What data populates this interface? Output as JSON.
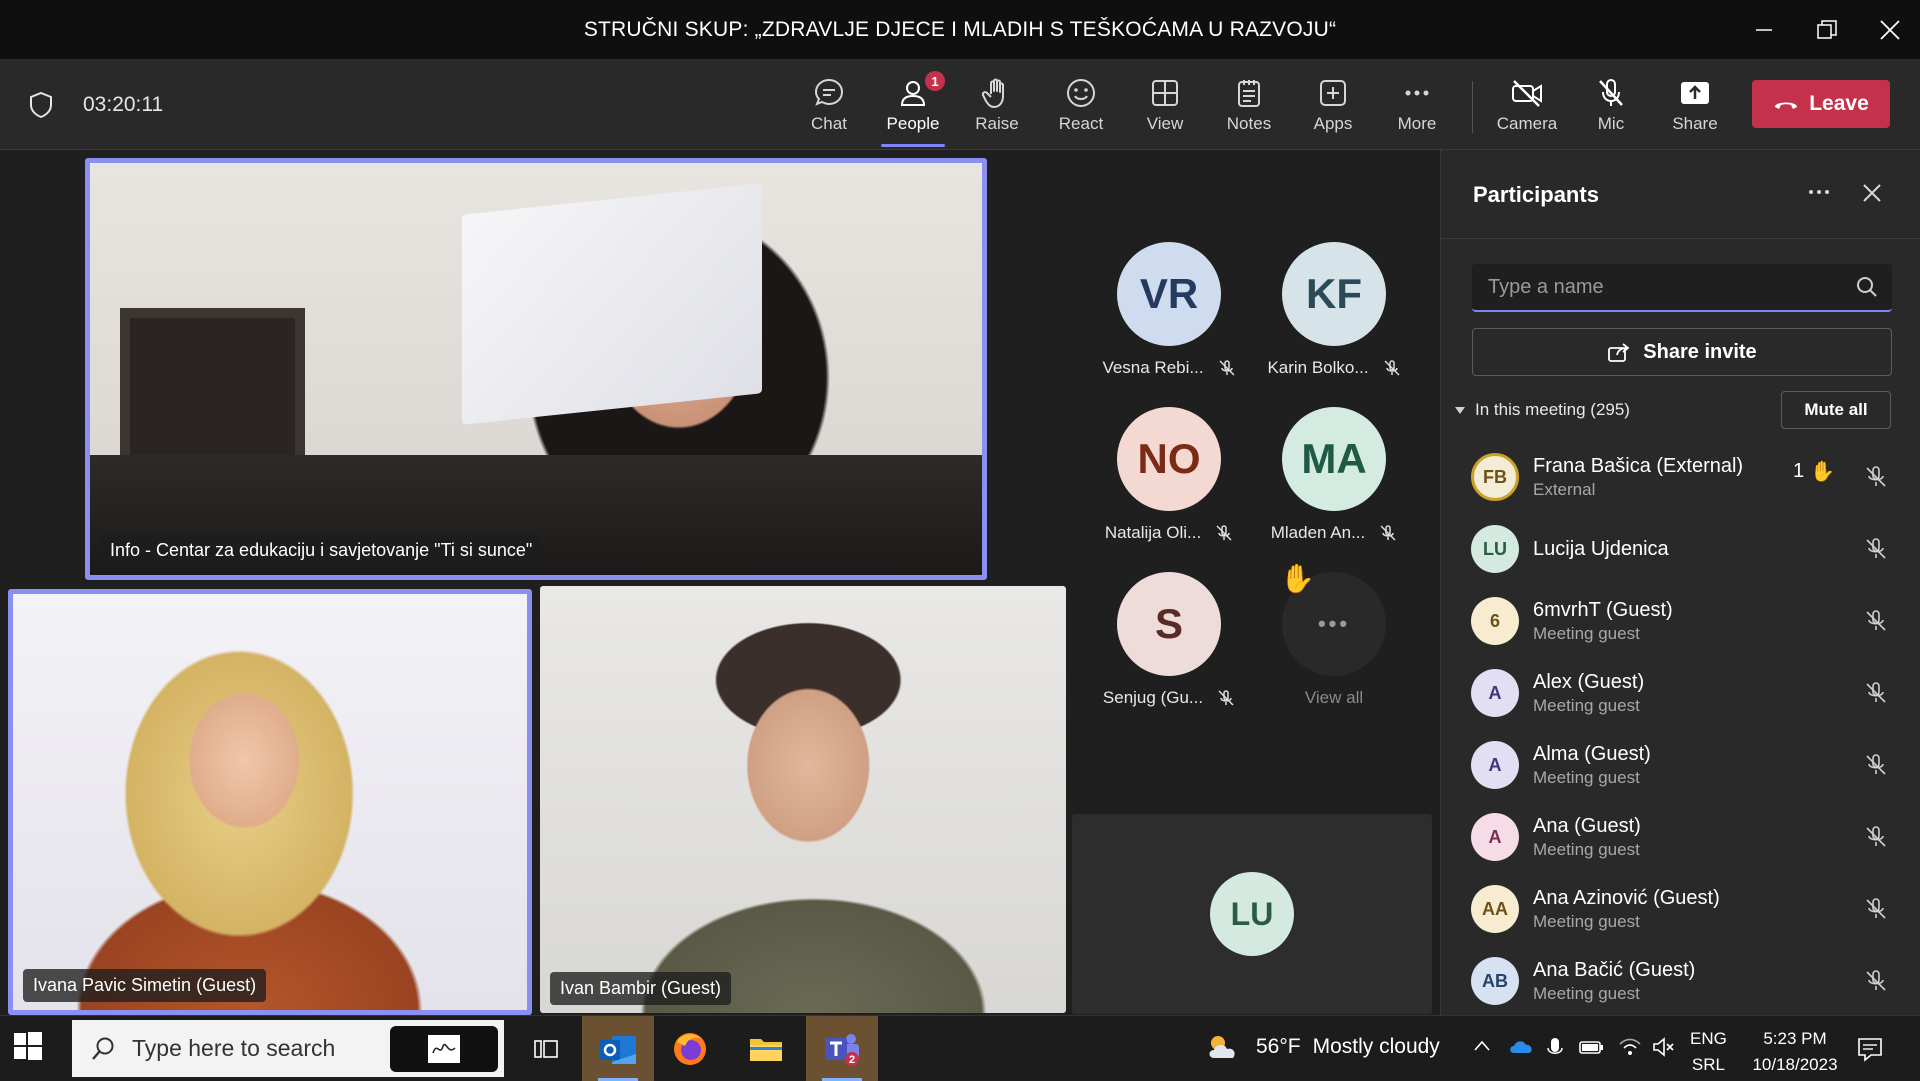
{
  "window": {
    "title": "STRUČNI SKUP: „ZDRAVLJE DJECE I MLADIH S TEŠKOĆAMA U RAZVOJU“"
  },
  "toolbar": {
    "timer": "03:20:11",
    "buttons": {
      "chat": "Chat",
      "people": "People",
      "people_badge": "1",
      "raise": "Raise",
      "react": "React",
      "view": "View",
      "notes": "Notes",
      "apps": "Apps",
      "more": "More",
      "camera": "Camera",
      "mic": "Mic",
      "share": "Share"
    },
    "leave": "Leave"
  },
  "stage": {
    "main_tile": {
      "name": "Info - Centar za edukaciju i savjetovanje \"Ti si sunce\""
    },
    "tile_left": {
      "name": "Ivana Pavic Simetin (Guest)"
    },
    "tile_right": {
      "name": "Ivan Bambir (Guest)"
    },
    "avatars": [
      {
        "initials": "VR",
        "name": "Vesna Rebi...",
        "bg": "#cfdcef",
        "fg": "#243a5e"
      },
      {
        "initials": "KF",
        "name": "Karin Bolko...",
        "bg": "#d6e4ea",
        "fg": "#2b4a57"
      },
      {
        "initials": "NO",
        "name": "Natalija Oli...",
        "bg": "#f3d9d2",
        "fg": "#7a2a16"
      },
      {
        "initials": "MA",
        "name": "Mladen An...",
        "bg": "#d4ebe2",
        "fg": "#1f5a45"
      },
      {
        "initials": "S",
        "name": "Senjug (Gu...",
        "bg": "#eddcda",
        "fg": "#5a2b25"
      }
    ],
    "view_all": {
      "label": "View all",
      "dots": "•••"
    },
    "self_tile": {
      "initials": "LU"
    }
  },
  "panel": {
    "title": "Participants",
    "search_placeholder": "Type a name",
    "share_invite": "Share invite",
    "section": "In this meeting (295)",
    "mute_all": "Mute all",
    "participants": [
      {
        "initials": "FB",
        "name": "Frana Bašica (External)",
        "role": "External",
        "bg": "#f3ecd6",
        "fg": "#6b5318",
        "hand": "1"
      },
      {
        "initials": "LU",
        "name": "Lucija Ujdenica",
        "role": "",
        "bg": "#d4e9e0",
        "fg": "#2a5a48"
      },
      {
        "initials": "6",
        "name": "6mvrhT (Guest)",
        "role": "Meeting guest",
        "bg": "#f7ecd0",
        "fg": "#6b5318"
      },
      {
        "initials": "A",
        "name": "Alex (Guest)",
        "role": "Meeting guest",
        "bg": "#e2dff4",
        "fg": "#3e3775"
      },
      {
        "initials": "A",
        "name": "Alma (Guest)",
        "role": "Meeting guest",
        "bg": "#e2dff4",
        "fg": "#3e3775"
      },
      {
        "initials": "A",
        "name": "Ana (Guest)",
        "role": "Meeting guest",
        "bg": "#f6dce6",
        "fg": "#7a2e4c"
      },
      {
        "initials": "AA",
        "name": "Ana Azinović (Guest)",
        "role": "Meeting guest",
        "bg": "#f7ecd0",
        "fg": "#6b5318"
      },
      {
        "initials": "AB",
        "name": "Ana Bačić (Guest)",
        "role": "Meeting guest",
        "bg": "#d6e2f1",
        "fg": "#27436b"
      }
    ]
  },
  "taskbar": {
    "search_placeholder": "Type here to search",
    "weather_temp": "56°F",
    "weather_text": "Mostly cloudy",
    "lang_1": "ENG",
    "lang_2": "SRL",
    "time": "5:23 PM",
    "date": "10/18/2023",
    "teams_badge": "2"
  },
  "colors": {
    "accent": "#7f85f5",
    "leave": "#c4314b",
    "panel_bg": "#292929",
    "stage_bg": "#1f1f1f"
  }
}
